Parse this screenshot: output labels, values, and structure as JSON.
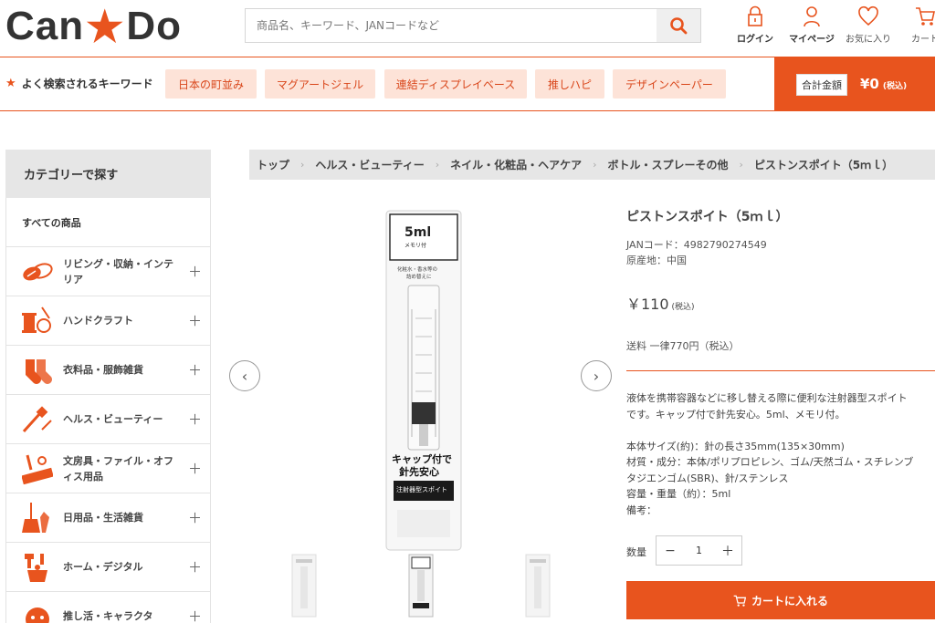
{
  "header": {
    "logo_left": "Can",
    "logo_star": "★",
    "logo_right": "Do",
    "search_placeholder": "商品名、キーワード、JANコードなど",
    "icons": [
      {
        "name": "lock-icon",
        "label": "ログイン"
      },
      {
        "name": "user-icon",
        "label": "マイページ"
      },
      {
        "name": "heart-icon",
        "label": "お気に入り"
      },
      {
        "name": "cart-icon",
        "label": "カート"
      }
    ]
  },
  "keywords": {
    "star": "★",
    "title": "よく検索されるキーワード",
    "items": [
      "日本の町並み",
      "マグアートジェル",
      "連結ディスプレイベース",
      "推しハピ",
      "デザインペーパー"
    ],
    "total_label": "合計金額",
    "total_value": "¥0",
    "total_tax": "(税込)"
  },
  "sidebar": {
    "heading": "カテゴリーで探す",
    "all_label": "すべての商品",
    "items": [
      {
        "icon": "sponge-icon",
        "label": "リビング・収納・インテリア"
      },
      {
        "icon": "sewing-icon",
        "label": "ハンドクラフト"
      },
      {
        "icon": "socks-icon",
        "label": "衣料品・服飾雑貨"
      },
      {
        "icon": "brush-icon",
        "label": "ヘルス・ビューティー"
      },
      {
        "icon": "ruler-icon",
        "label": "文房具・ファイル・オフィス用品"
      },
      {
        "icon": "broom-icon",
        "label": "日用品・生活雑貨"
      },
      {
        "icon": "tools-icon",
        "label": "ホーム・デジタル"
      },
      {
        "icon": "character-icon",
        "label": "推し活・キャラクタ"
      }
    ],
    "plus": "＋"
  },
  "breadcrumb": [
    "トップ",
    "ヘルス・ビューティー",
    "ネイル・化粧品・ヘアケア",
    "ボトル・スプレーその他",
    "ピストンスポイト（5ｍｌ）"
  ],
  "breadcrumb_sep": "›",
  "product": {
    "title": "ピストンスポイト（5ｍｌ）",
    "jan": "JANコード：4982790274549",
    "origin": "原産地：中国",
    "price": "￥110",
    "price_tax": "(税込)",
    "shipping": "送料 一律770円（税込）",
    "desc_lines": [
      "液体を携帯容器などに移し替える際に便利な注射器型スポイト",
      "です。キャップ付で針先安心。5ml、メモリ付。",
      "",
      "本体サイズ(約)：針の長さ35mm(135×30mm)",
      "材質・成分：本体/ポリプロピレン、ゴム/天然ゴム・スチレンブ",
      "タジエンゴム(SBR)、針/ステンレス",
      "容量・重量（約）：5ml",
      "備考："
    ],
    "qty_label": "数量",
    "qty_minus": "−",
    "qty_value": "1",
    "qty_plus": "＋",
    "cart_button": "カートに入れる"
  },
  "package": {
    "size": "5ml",
    "memo": "メモリ付",
    "label1": "化粧水・香水等の",
    "label2": "詰め替えに",
    "catch1": "キャップ付で",
    "catch2": "針先安心",
    "type": "注射器型スポイト"
  },
  "gallery": {
    "prev": "‹",
    "next": "›"
  },
  "colors": {
    "accent": "#e8541e",
    "chip_bg": "#fde3d8",
    "chip_text": "#d9461a"
  }
}
